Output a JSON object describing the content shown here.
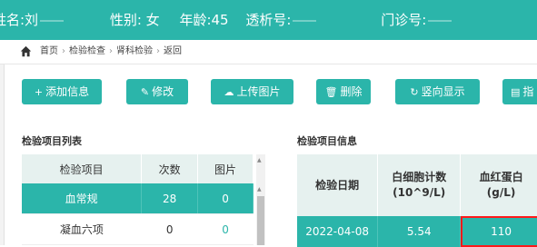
{
  "header": {
    "name": "姓名:刘",
    "gender": "性别: 女",
    "age": "年龄:45",
    "dialysis_no": "透析号:",
    "clinic_no": "门诊号:"
  },
  "breadcrumb": [
    "首页",
    "检验检查",
    "肾科检验",
    "返回"
  ],
  "toolbar": [
    {
      "icon": "+",
      "label": "添加信息"
    },
    {
      "icon": "✎",
      "label": "修改"
    },
    {
      "icon": "☁",
      "label": "上传图片"
    },
    {
      "icon": "🗑",
      "label": "删除"
    },
    {
      "icon": "↻",
      "label": "竖向显示"
    },
    {
      "icon": "▤",
      "label": "指"
    }
  ],
  "left_panel": {
    "title": "检验项目列表",
    "columns": [
      "检验项目",
      "次数",
      "图片"
    ],
    "rows": [
      {
        "item": "血常规",
        "count": "28",
        "images": "0"
      },
      {
        "item": "凝血六项",
        "count": "0",
        "images": "0"
      }
    ]
  },
  "right_panel": {
    "title": "检验项目信息",
    "columns": [
      "检验日期",
      "白细胞计数\n(10^9/L)",
      "血红蛋白\n(g/L)"
    ],
    "rows": [
      {
        "date": "2022-04-08",
        "wbc": "5.54",
        "hgb": "110"
      }
    ]
  },
  "colors": {
    "accent": "#2bb5aa",
    "highlight_border": "#ff1a1a"
  }
}
